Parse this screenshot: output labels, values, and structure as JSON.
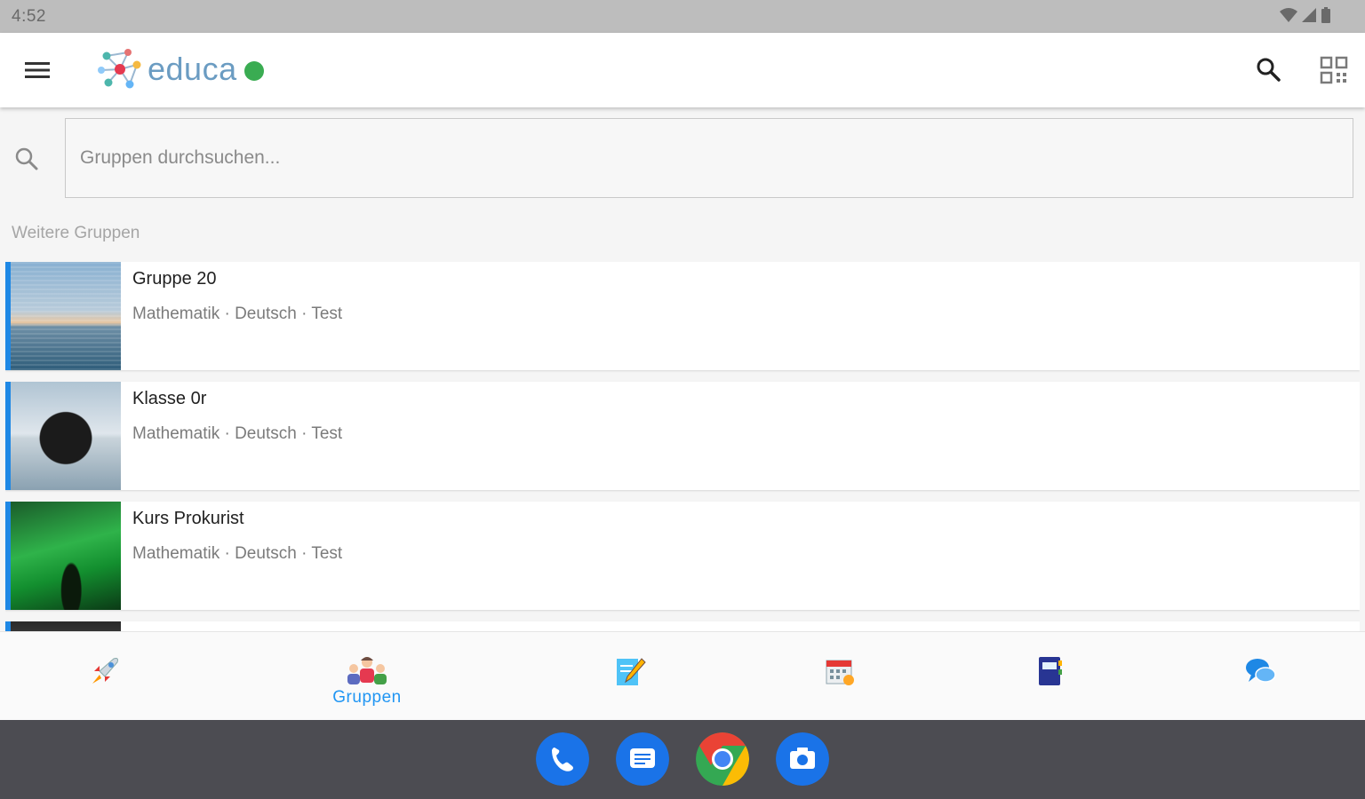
{
  "status_bar": {
    "time": "4:52"
  },
  "app_bar": {
    "app_name": "educa"
  },
  "search": {
    "placeholder": "Gruppen durchsuchen..."
  },
  "section": {
    "label": "Weitere Gruppen"
  },
  "groups": [
    {
      "name": "Gruppe 20",
      "subjects": "Mathematik · Deutsch · Test",
      "thumb": "sea-horizon-image"
    },
    {
      "name": "Klasse 0r",
      "subjects": "Mathematik · Deutsch · Test",
      "thumb": "lake-rock-image"
    },
    {
      "name": "Kurs Prokurist",
      "subjects": "Mathematik · Deutsch · Test",
      "thumb": "aurora-image"
    }
  ],
  "bottom_nav": {
    "items": [
      {
        "icon": "rocket-icon"
      },
      {
        "icon": "group-people-icon",
        "label": "Gruppen",
        "active": true
      },
      {
        "icon": "notepad-pencil-icon"
      },
      {
        "icon": "calendar-icon"
      },
      {
        "icon": "notebook-icon"
      },
      {
        "icon": "chat-bubbles-icon"
      }
    ]
  },
  "dock": {
    "apps": [
      "phone-icon",
      "messages-icon",
      "chrome-icon",
      "camera-icon"
    ]
  },
  "colors": {
    "accent": "#2196f3",
    "online": "#3aac52",
    "card_accent": "#1e88e5",
    "dock": "#4c4c52"
  }
}
